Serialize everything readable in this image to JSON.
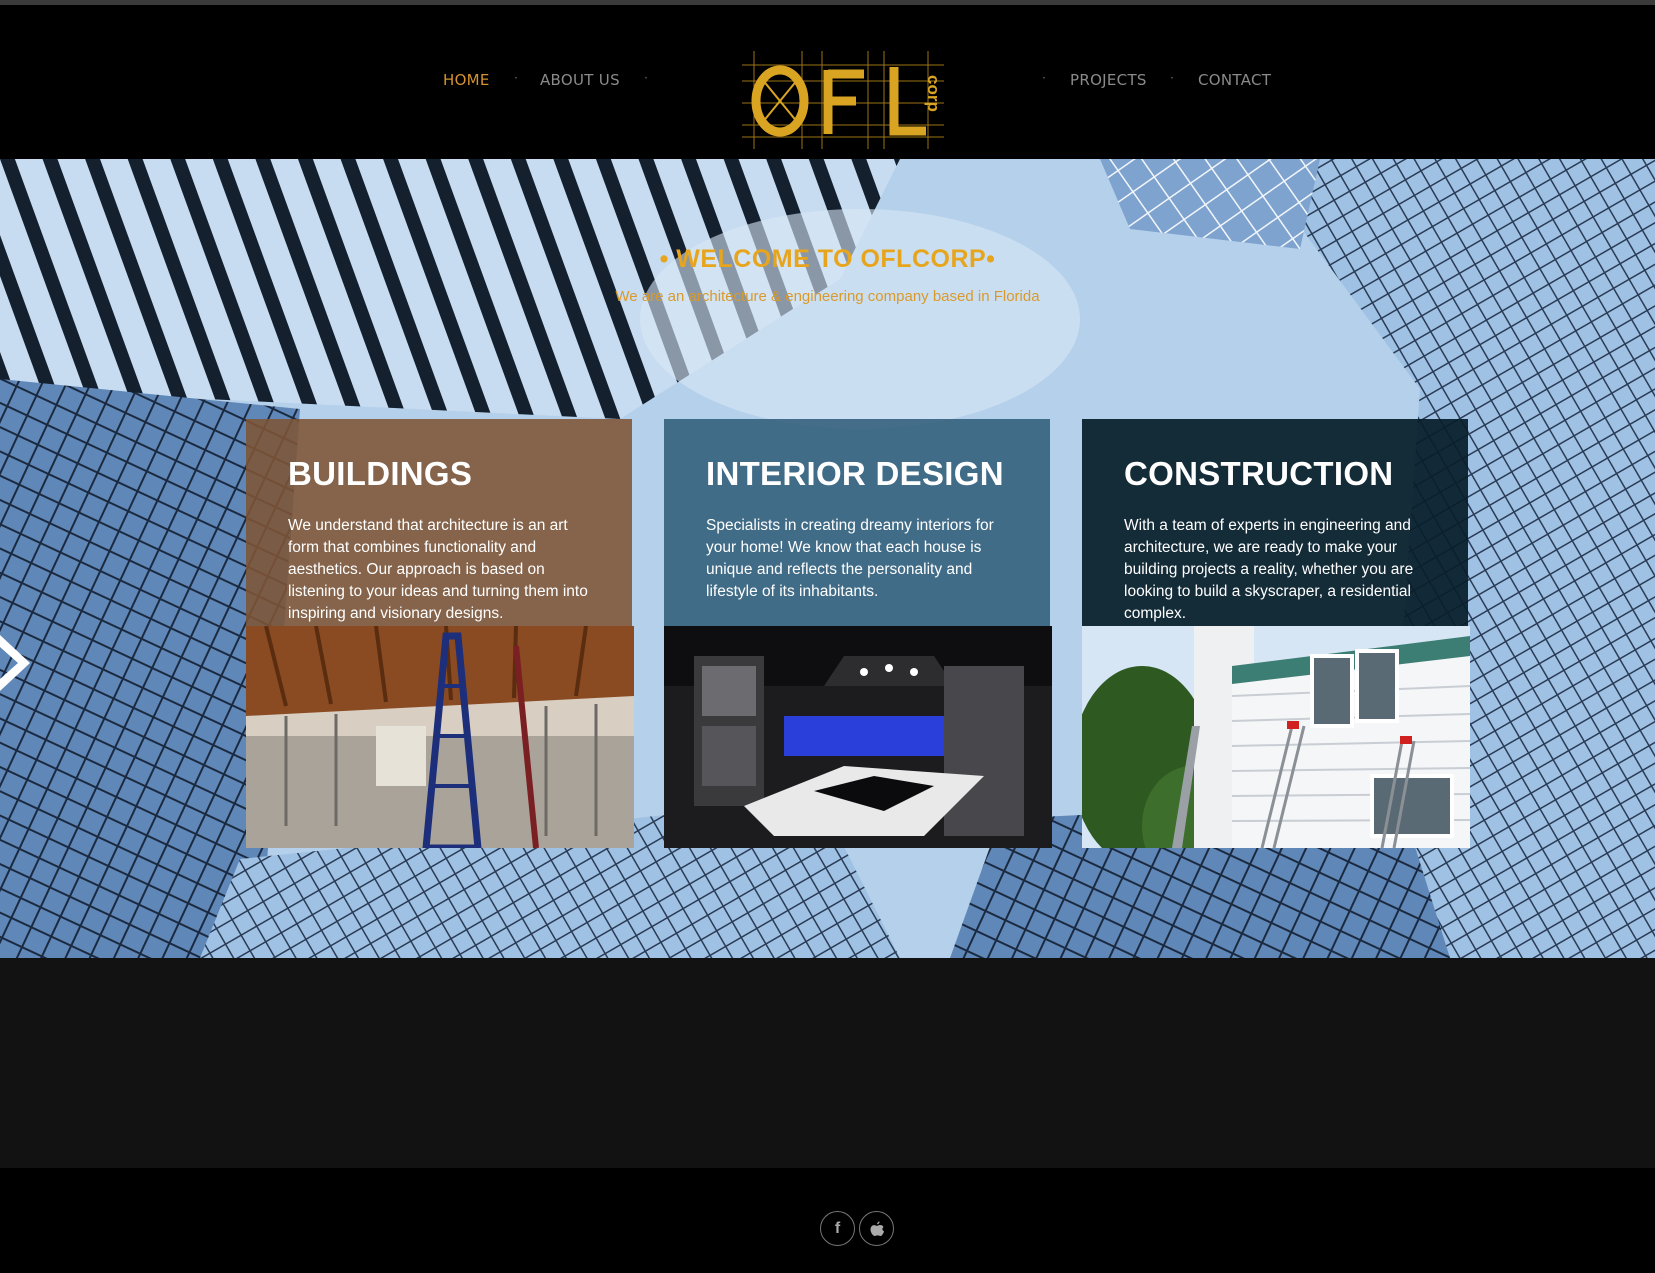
{
  "nav": {
    "home": "HOME",
    "about": "ABOUT US",
    "projects": "PROJECTS",
    "contact": "CONTACT",
    "separator": "·"
  },
  "logo": {
    "text": "OFL",
    "tag": "corp",
    "color": "#d9a421"
  },
  "hero": {
    "title": "• WELCOME TO OFLCORP•",
    "subtitle": "We are an architecture & engineering company based in Florida"
  },
  "cards": [
    {
      "title": "BUILDINGS",
      "text": "We understand that architecture is an art form that combines functionality and aesthetics. Our approach is based on listening to your ideas and turning them into inspiring and visionary designs.",
      "color": "#7e5434"
    },
    {
      "title": "INTERIOR DESIGN",
      "text": "Specialists in creating dreamy interiors for your home! We know that each house is unique and reflects the personality and lifestyle of its inhabitants.",
      "color": "#34607c"
    },
    {
      "title": "CONSTRUCTION",
      "text": "With a team of experts in engineering and architecture, we are ready to make your building projects a reality, whether you are looking to build a skyscraper, a residential complex.",
      "color": "#081e2a"
    }
  ],
  "footer": {
    "social": [
      {
        "icon": "facebook-icon",
        "glyph": "f"
      },
      {
        "icon": "apple-icon",
        "glyph": ""
      }
    ]
  },
  "colors": {
    "accent": "#d4912f",
    "title": "#e7a51d"
  }
}
